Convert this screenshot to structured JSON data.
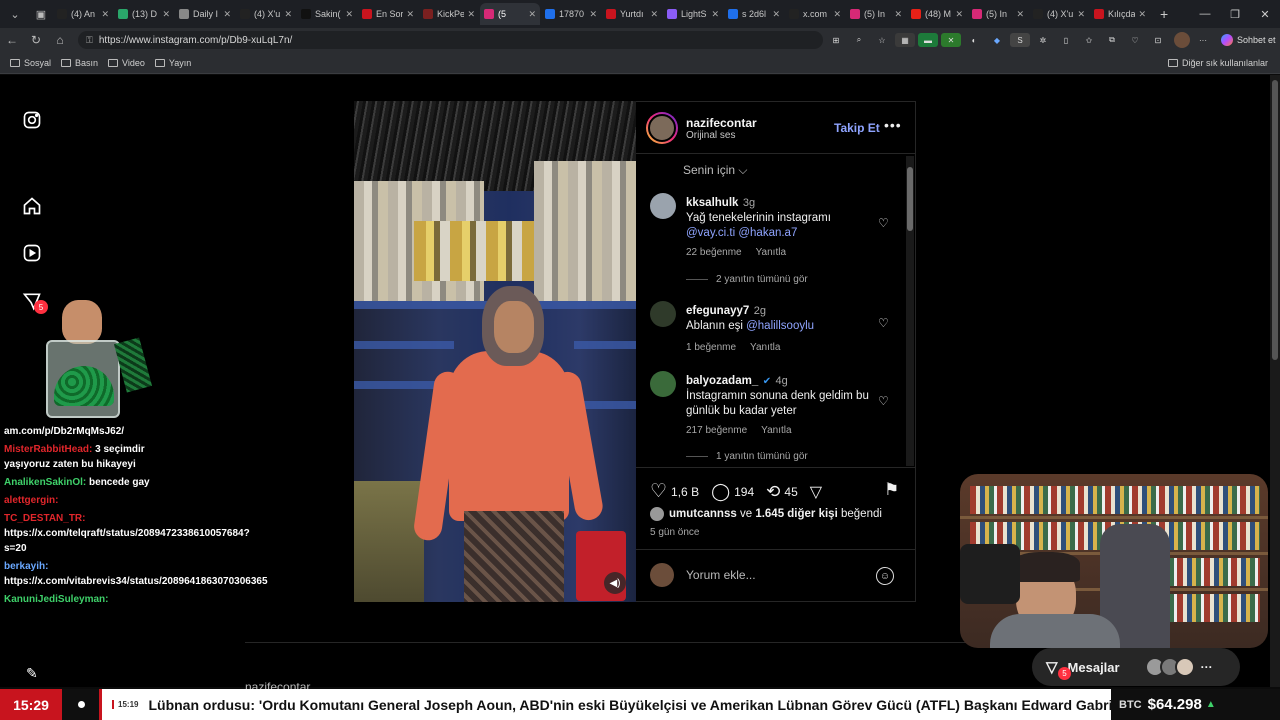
{
  "browser": {
    "tabs": [
      {
        "label": "(4) An",
        "color": "#222"
      },
      {
        "label": "(13) D",
        "color": "#2aa66a"
      },
      {
        "label": "Daily I",
        "color": "#888"
      },
      {
        "label": "(4) X'u",
        "color": "#222"
      },
      {
        "label": "Sakin(",
        "color": "#111"
      },
      {
        "label": "En Sor",
        "color": "#c8141e"
      },
      {
        "label": "KickPe",
        "color": "#7a2020"
      },
      {
        "label": "(5",
        "color": "#d62976",
        "active": true
      },
      {
        "label": "17870",
        "color": "#1f6feb"
      },
      {
        "label": "Yurtdı",
        "color": "#c8141e"
      },
      {
        "label": "LightS",
        "color": "#8a5cf6"
      },
      {
        "label": "s 2d6l",
        "color": "#1f6feb"
      },
      {
        "label": "x.com",
        "color": "#222"
      },
      {
        "label": "(5) In",
        "color": "#d62976"
      },
      {
        "label": "(48) M",
        "color": "#e62117"
      },
      {
        "label": "(5) In",
        "color": "#d62976"
      },
      {
        "label": "(4) X'u",
        "color": "#222"
      },
      {
        "label": "Kılıçda",
        "color": "#c8141e"
      }
    ],
    "url": "https://www.instagram.com/p/Db9-xuLqL7n/",
    "copilot_label": "Sohbet et",
    "bookmarks": [
      "Sosyal",
      "Basın",
      "Video",
      "Yayın"
    ],
    "other_bookmarks": "Diğer sık kullanılanlar"
  },
  "post": {
    "username": "nazifecontar",
    "audio": "Orijinal ses",
    "follow": "Takip Et",
    "filter": "Senin için",
    "comments": [
      {
        "user": "kksalhulk",
        "time": "3g",
        "text": "Yağ tenekelerinin instagramı",
        "mentions": "@vay.ci.ti @hakan.a7",
        "likes": "22 beğenme",
        "reply": "Yanıtla",
        "more_replies": "2 yanıtın tümünü gör"
      },
      {
        "user": "efegunayy7",
        "time": "2g",
        "text": "Ablanın eşi",
        "mentions": "@halillsooylu",
        "likes": "1 beğenme",
        "reply": "Yanıtla"
      },
      {
        "user": "balyozadam_",
        "time": "4g",
        "text": "İnstagramın sonuna denk geldim bu günlük bu kadar yeter",
        "likes": "217 beğenme",
        "reply": "Yanıtla",
        "more_replies": "1 yanıtın tümünü gör"
      }
    ],
    "like_count": "1,6 B",
    "comment_count": "194",
    "repost_count": "45",
    "liked_by_user": "umutcannss",
    "liked_by_rest": "ve",
    "liked_by_others": "1.645 diğer kişi",
    "liked_by_suffix": "beğendi",
    "ago": "5 gün önce",
    "add_comment": "Yorum ekle...",
    "more_posts_prefix": "nazifecontar"
  },
  "stream": {
    "chat": [
      {
        "name": "",
        "name_color": "#fff",
        "text": "am.com/p/Db2rMqMsJ62/"
      },
      {
        "name": "MisterRabbitHead:",
        "name_color": "#e0262b",
        "text": "3 seçimdir yaşıyoruz zaten bu hikayeyi"
      },
      {
        "name": "AnalikenSakinOl:",
        "name_color": "#3fd16a",
        "text": "bencede gay"
      },
      {
        "name": "alettgergin:",
        "name_color": "#e0262b",
        "text": ""
      },
      {
        "name": "TC_DESTAN_TR:",
        "name_color": "#e0262b",
        "text": "https://x.com/telqraft/status/2089472338610057684?s=20"
      },
      {
        "name": "berkayih:",
        "name_color": "#6aa8ff",
        "text": "https://x.com/vitabrevis34/status/2089641863070306365"
      },
      {
        "name": "KanuniJediSuleyman:",
        "name_color": "#3fd16a",
        "text": ""
      }
    ],
    "messages_label": "Mesajlar",
    "messages_badge": "5",
    "notif_badge": "5"
  },
  "ticker": {
    "clock": "15:29",
    "item_time": "15:19",
    "headline": "Lübnan ordusu: 'Ordu Komutanı General Joseph Aoun, ABD'nin eski Büyükelçisi ve Amerikan Lübnan Görev Gücü (ATFL) Başkanı Edward Gabriel'i,",
    "btc_label": "BTC",
    "btc_price": "$64.298",
    "btc_trend": "▲"
  }
}
